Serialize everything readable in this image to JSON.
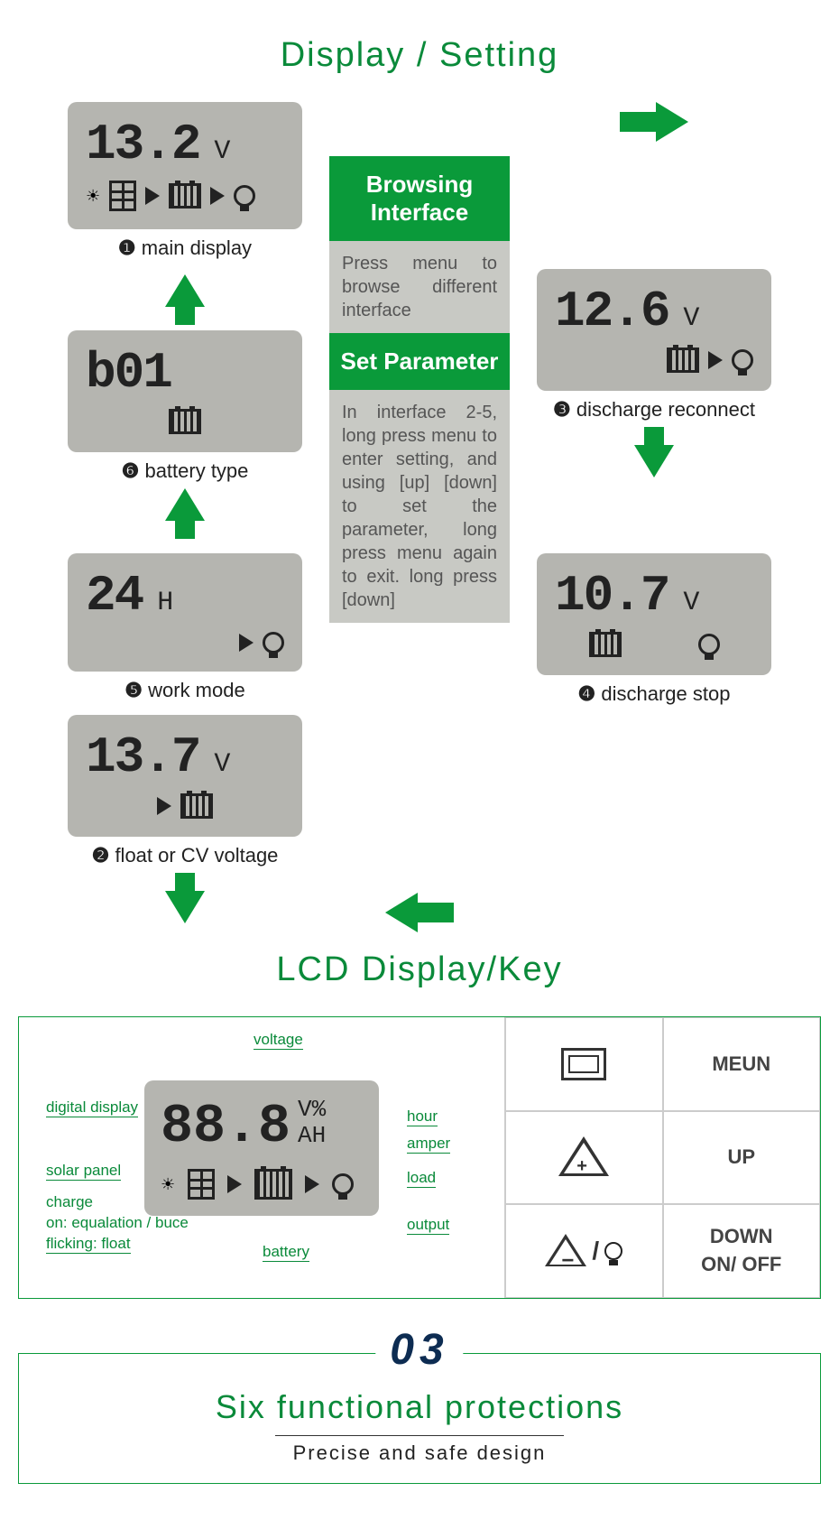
{
  "titles": {
    "display_setting": "Display / Setting",
    "lcd_display_key": "LCD Display/Key"
  },
  "screens": {
    "main": {
      "value": "13.2",
      "unit": "V",
      "caption_num": "❶",
      "caption": "main display"
    },
    "float": {
      "value": "13.7",
      "unit": "V",
      "caption_num": "❷",
      "caption": "float or CV voltage"
    },
    "batt": {
      "value": "b01",
      "unit": "",
      "caption_num": "❻",
      "caption": "battery type"
    },
    "reconn": {
      "value": "12.6",
      "unit": "V",
      "caption_num": "❸",
      "caption": "discharge reconnect"
    },
    "work": {
      "value": "24",
      "unit": "H",
      "caption_num": "❺",
      "caption": "work mode"
    },
    "stop": {
      "value": "10.7",
      "unit": "V",
      "caption_num": "❹",
      "caption": "discharge stop"
    }
  },
  "mid": {
    "browsing_title": "Browsing Interface",
    "browsing_text": "Press menu to browse different interface",
    "set_title": "Set Parameter",
    "set_text": "In interface 2-5, long press menu to enter setting, and using [up] [down] to set the parameter, long press menu again to exit. long press [down]"
  },
  "lcd_big": {
    "value": "88.8",
    "units_line1": "V%",
    "units_line2": "AH"
  },
  "callouts": {
    "voltage": "voltage",
    "digital_display": "digital display",
    "hour": "hour",
    "amper": "amper",
    "solar_panel": "solar panel",
    "load": "load",
    "charge": "charge",
    "on_equal": "on: equalation / buce",
    "flicking": "flicking: float",
    "output": "output",
    "battery": "battery"
  },
  "keys": {
    "menu": "MEUN",
    "up": "UP",
    "down": "DOWN\nON/ OFF"
  },
  "footer": {
    "num": "03",
    "title": "Six functional protections",
    "sub": "Precise and safe design"
  }
}
